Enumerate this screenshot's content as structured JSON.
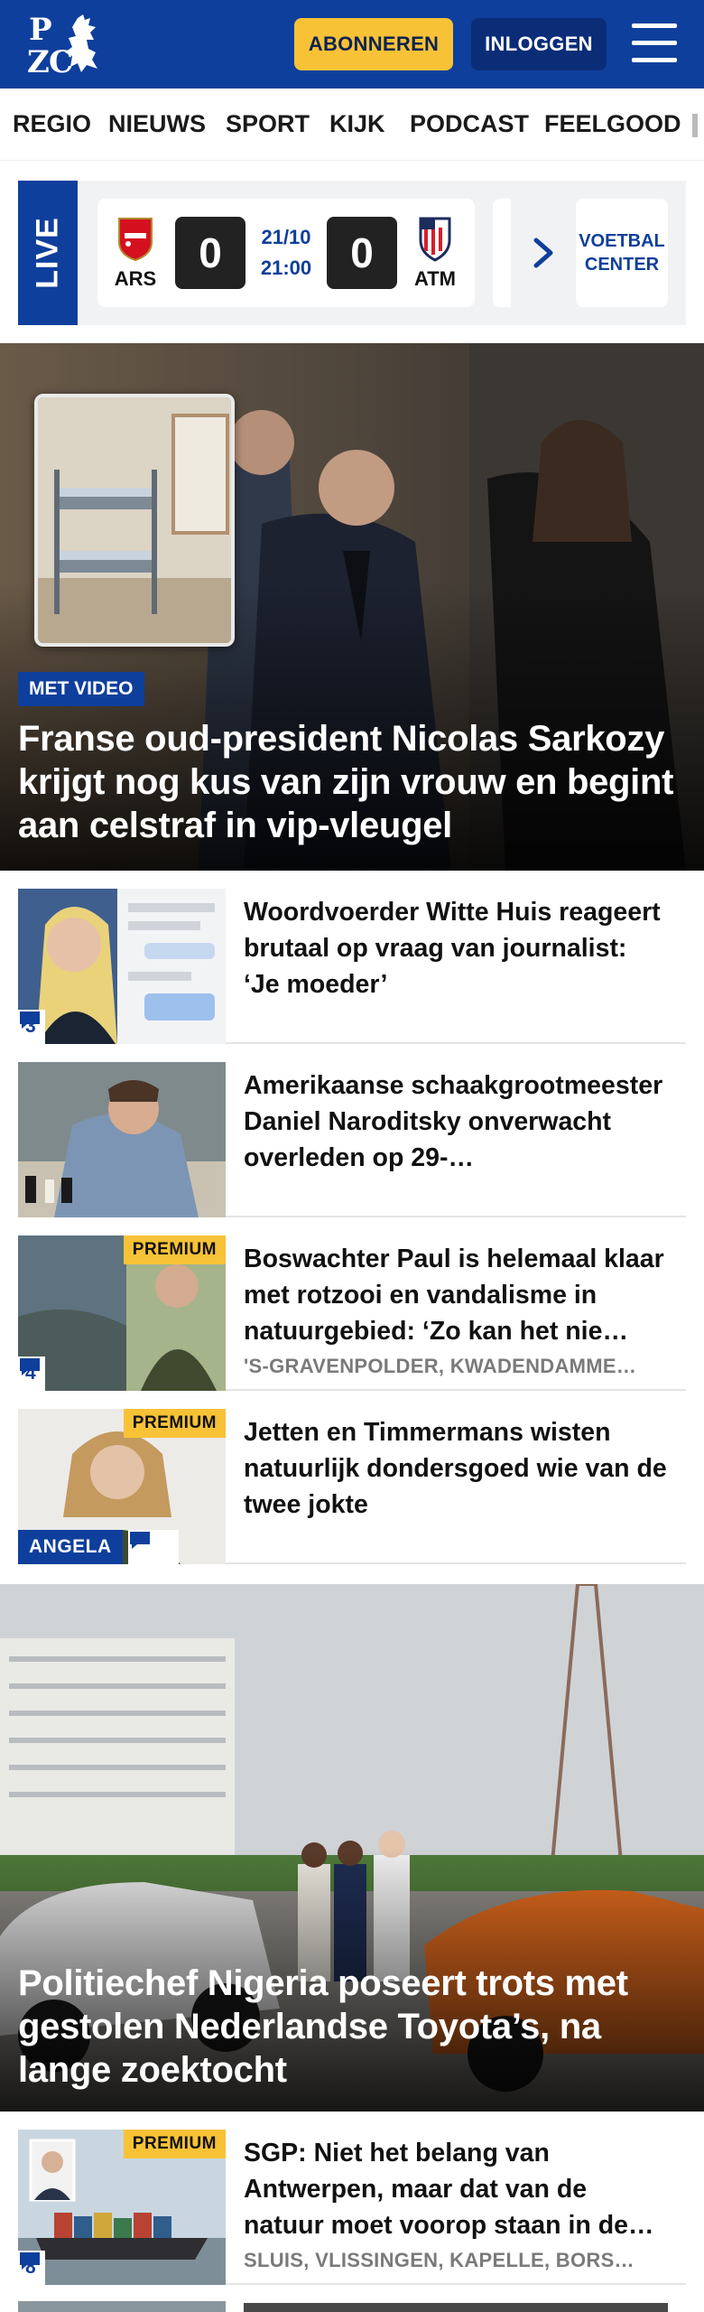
{
  "header": {
    "logo_letters": [
      "P",
      "Z",
      "C"
    ],
    "subscribe_label": "ABONNEREN",
    "login_label": "INLOGGEN",
    "brand_color": "#0f3f9c",
    "accent_color": "#f8c237"
  },
  "nav": {
    "items": [
      "REGIO",
      "NIEUWS",
      "SPORT",
      "KIJK",
      "PODCAST",
      "FEELGOOD"
    ]
  },
  "live": {
    "tag": "LIVE",
    "match": {
      "home_code": "ARS",
      "away_code": "ATM",
      "home_score": "0",
      "away_score": "0",
      "date": "21/10",
      "time": "21:00"
    },
    "center_label_1": "VOETBAL",
    "center_label_2": "CENTER"
  },
  "hero": {
    "badge": "MET VIDEO",
    "title": "Franse oud-president Nicolas Sarkozy krijgt nog kus van zijn vrouw en begint aan celstraf in vip-vleugel"
  },
  "articles": [
    {
      "title": "Woordvoerder Witte Huis reageert brutaal op vraag van journalist: ‘Je moeder’",
      "comments": "3"
    },
    {
      "title": "Amerikaanse schaakgrootmees­ter Daniel Naroditsky onverwacht overleden op 29-…"
    },
    {
      "title": "Boswachter Paul is helemaal klaar met rotzooi en vandalisme in natuurgebied: ‘Zo kan het nie…",
      "premium": "PREMIUM",
      "subtitle": "'S-GRAVENPOLDER, KWADENDAMME…",
      "comments": "4"
    },
    {
      "title": "Jetten en Timmermans wisten natuurlijk dondersgoed wie van de twee jokte",
      "premium": "PREMIUM",
      "author": "ANGELA"
    }
  ],
  "hero2": {
    "title": "Politiechef Nigeria poseert trots met gestolen Nederlandse Toyota’s, na lange zoektocht"
  },
  "articles2": [
    {
      "title": "SGP: Niet het belang van Antwerpen, maar dat van de natuur moet voorop staan in de…",
      "premium": "PREMIUM",
      "subtitle": "SLUIS, VLISSINGEN, KAPELLE, BORS…",
      "comments": "8"
    }
  ]
}
